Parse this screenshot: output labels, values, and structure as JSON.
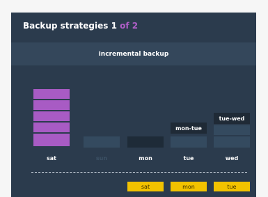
{
  "header": {
    "title": "Backup strategies 1",
    "of_text": "of 2"
  },
  "banner": {
    "label": "incremental backup"
  },
  "days": [
    {
      "label": "sat",
      "faded": false
    },
    {
      "label": "sun",
      "faded": true
    },
    {
      "label": "mon",
      "faded": false
    },
    {
      "label": "tue",
      "faded": false
    },
    {
      "label": "wed",
      "faded": false
    }
  ],
  "backup_labels": {
    "tue": "mon-tue",
    "wed": "tue-wed"
  },
  "timeline_chips": [
    "sat",
    "mon",
    "tue"
  ],
  "colors": {
    "background": "#2b3b4d",
    "banner": "#34475b",
    "full_backup": "#a85bc4",
    "chip": "#f2c200",
    "of_text": "#b05fc8"
  }
}
